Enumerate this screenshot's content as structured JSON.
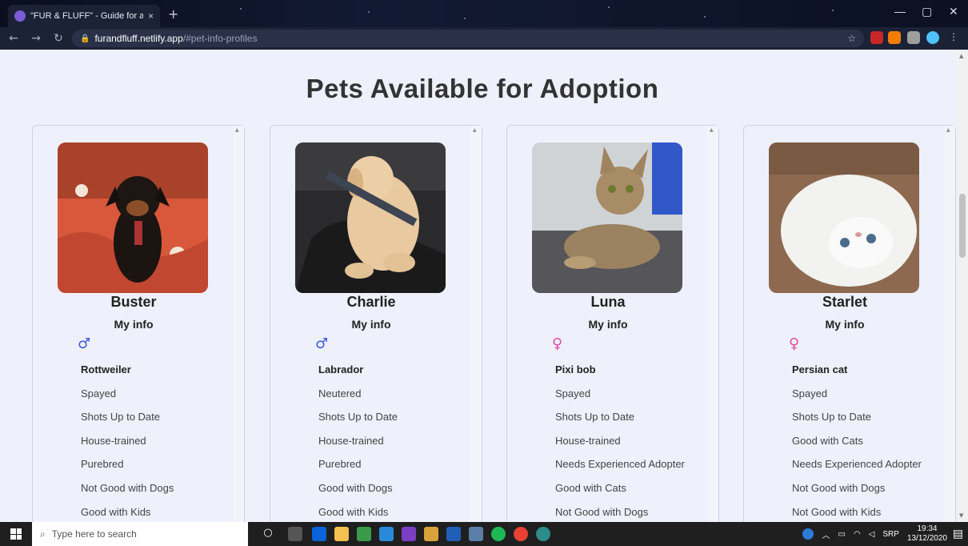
{
  "browser": {
    "tab_title": "\"FUR & FLUFF\" - Guide for adopt",
    "tab_close": "×",
    "new_tab": "+",
    "url_host": "furandfluff.netlify.app",
    "url_path": "/#pet-info-profiles",
    "window_controls": [
      "—",
      "▢",
      "✕"
    ]
  },
  "page": {
    "heading": "Pets Available for Adoption"
  },
  "pets": [
    {
      "name": "Buster",
      "info_label": "My info",
      "gender": "male",
      "gender_symbol": "♂",
      "breed": "Rottweiler",
      "traits": [
        "Spayed",
        "Shots Up to Date",
        "House-trained",
        "Purebred",
        "Not Good with Dogs",
        "Good with Kids"
      ]
    },
    {
      "name": "Charlie",
      "info_label": "My info",
      "gender": "male",
      "gender_symbol": "♂",
      "breed": "Labrador",
      "traits": [
        "Neutered",
        "Shots Up to Date",
        "House-trained",
        "Purebred",
        "Good with Dogs",
        "Good with Kids"
      ]
    },
    {
      "name": "Luna",
      "info_label": "My info",
      "gender": "female",
      "gender_symbol": "♀",
      "breed": "Pixi bob",
      "traits": [
        "Spayed",
        "Shots Up to Date",
        "House-trained",
        "Needs Experienced Adopter",
        "Good with Cats",
        "Not Good with Dogs"
      ]
    },
    {
      "name": "Starlet",
      "info_label": "My info",
      "gender": "female",
      "gender_symbol": "♀",
      "breed": "Persian cat",
      "traits": [
        "Spayed",
        "Shots Up to Date",
        "Good with Cats",
        "Needs Experienced Adopter",
        "Not Good with Dogs",
        "Not Good with Kids"
      ]
    }
  ],
  "taskbar": {
    "search_placeholder": "Type here to search",
    "tray_lang": "SRP",
    "time": "19:34",
    "date": "13/12/2020"
  },
  "colors": {
    "male": "#3c5ad8",
    "female": "#e04aa5",
    "accent": "#7b5bd6"
  }
}
